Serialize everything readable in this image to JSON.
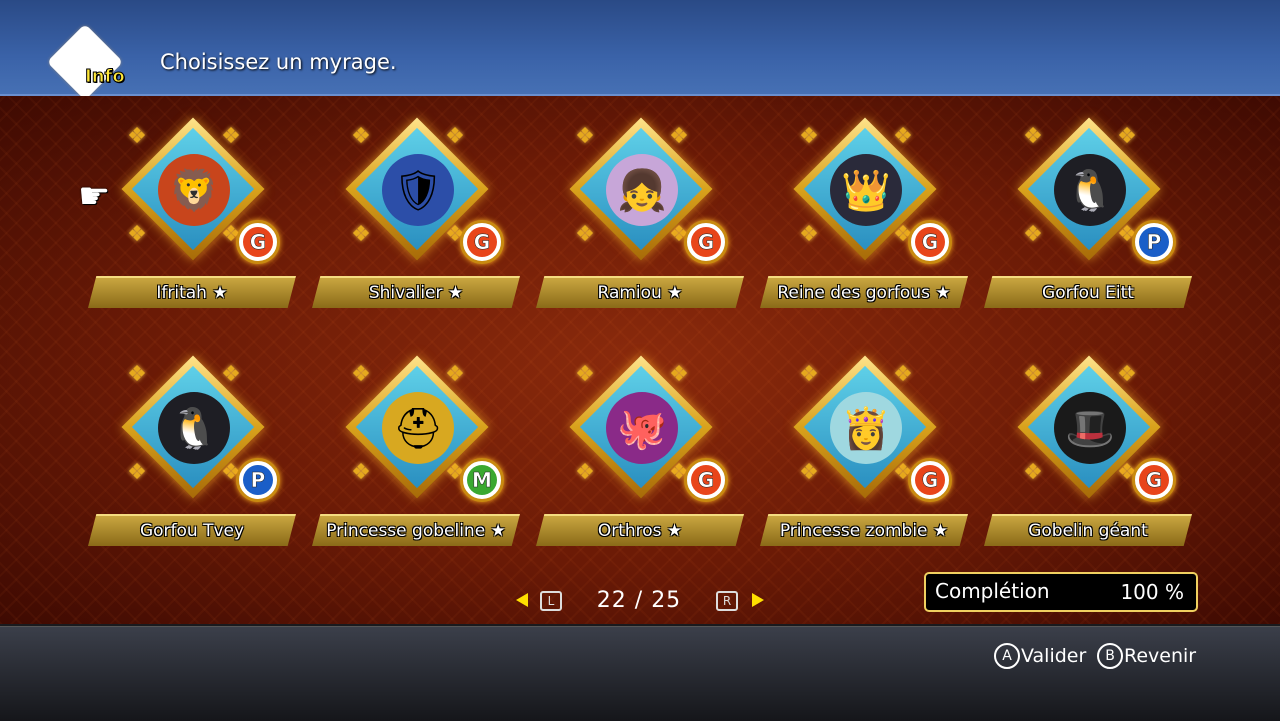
{
  "header": {
    "info_label": "Info",
    "prompt": "Choisissez un myrage."
  },
  "mirages": [
    {
      "name": "Ifritah ★",
      "type": "G",
      "type_color": "#e8451a",
      "portrait_color": "#c8451c",
      "portrait_glyph": "🦁"
    },
    {
      "name": "Shivalier ★",
      "type": "G",
      "type_color": "#e8451a",
      "portrait_color": "#2c4ea8",
      "portrait_glyph": "🛡"
    },
    {
      "name": "Ramiou ★",
      "type": "G",
      "type_color": "#e8451a",
      "portrait_color": "#c7a6d8",
      "portrait_glyph": "👧"
    },
    {
      "name": "Reine des gorfous ★",
      "type": "G",
      "type_color": "#e8451a",
      "portrait_color": "#2a2a3a",
      "portrait_glyph": "👑"
    },
    {
      "name": "Gorfou Eitt",
      "type": "P",
      "type_color": "#1a5ec8",
      "portrait_color": "#1e1e24",
      "portrait_glyph": "🐧"
    },
    {
      "name": "Gorfou Tvey",
      "type": "P",
      "type_color": "#1a5ec8",
      "portrait_color": "#1e1e24",
      "portrait_glyph": "🐧"
    },
    {
      "name": "Princesse gobeline ★",
      "type": "M",
      "type_color": "#3aa830",
      "portrait_color": "#d8a820",
      "portrait_glyph": "⛑"
    },
    {
      "name": "Orthros ★",
      "type": "G",
      "type_color": "#e8451a",
      "portrait_color": "#8a2a88",
      "portrait_glyph": "🐙"
    },
    {
      "name": "Princesse zombie ★",
      "type": "G",
      "type_color": "#e8451a",
      "portrait_color": "#9fd8e0",
      "portrait_glyph": "👸"
    },
    {
      "name": "Gobelin géant",
      "type": "G",
      "type_color": "#e8451a",
      "portrait_color": "#1a1a1a",
      "portrait_glyph": "🎩"
    }
  ],
  "pager": {
    "left_key": "L",
    "right_key": "R",
    "page": "22 / 25"
  },
  "completion": {
    "label": "Complétion",
    "value": "100 %"
  },
  "footer": {
    "confirm_key": "A",
    "confirm_label": "Valider",
    "back_key": "B",
    "back_label": "Revenir"
  },
  "colors": {
    "accent_gold": "#d9a21c",
    "pager_arrow": "#ffe000",
    "header_blue": "#3a62a8",
    "background_red": "#7a220a"
  },
  "icons": [
    "info-icon",
    "pointer-hand-icon",
    "arrow-left-icon",
    "arrow-right-icon"
  ]
}
